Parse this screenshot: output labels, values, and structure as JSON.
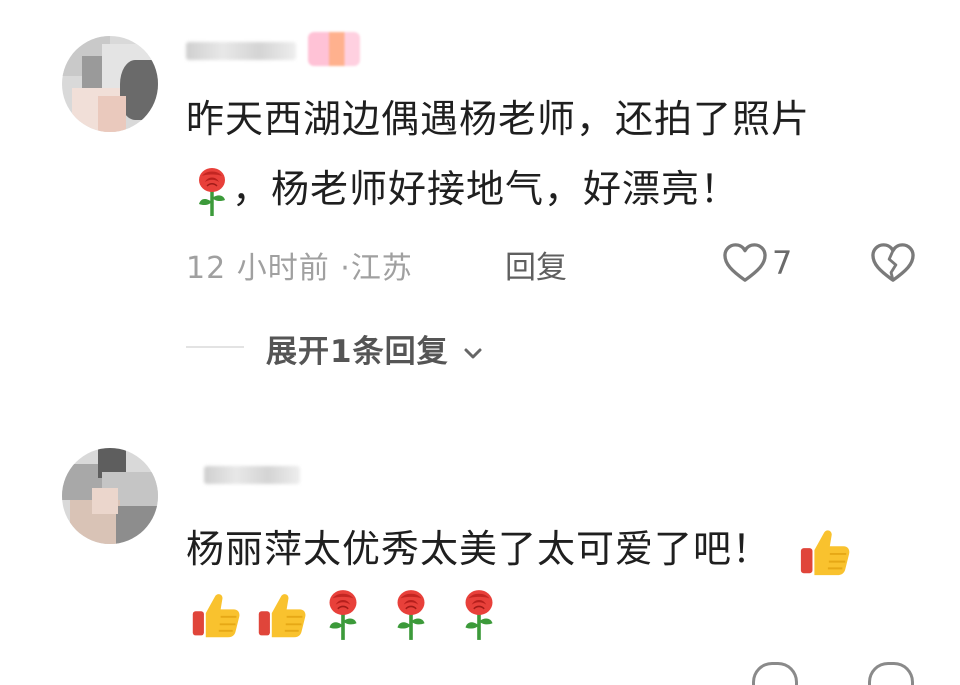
{
  "comments": [
    {
      "text_line1": "昨天西湖边偶遇杨老师，还拍了照片",
      "text_line2": "，杨老师好接地气，好漂亮！",
      "time": "12 小时前",
      "location": "江苏",
      "meta_sep": "·",
      "reply_label": "回复",
      "likes": "7",
      "expand_label": "展开1条回复",
      "inline_emoji": "rose-emoji"
    },
    {
      "text": "杨丽萍太优秀太美了太可爱了吧！",
      "trailing_emoji": "thumbs-up-emoji",
      "emoji_row": [
        "thumbs-up-emoji",
        "thumbs-up-emoji",
        "rose-emoji",
        "rose-emoji",
        "rose-emoji"
      ]
    }
  ],
  "colors": {
    "text": "#1f1f1f",
    "meta": "#a0a0a0",
    "reply": "#5f5f5f",
    "rose": "#e8403a",
    "thumb": "#f9c22e"
  }
}
